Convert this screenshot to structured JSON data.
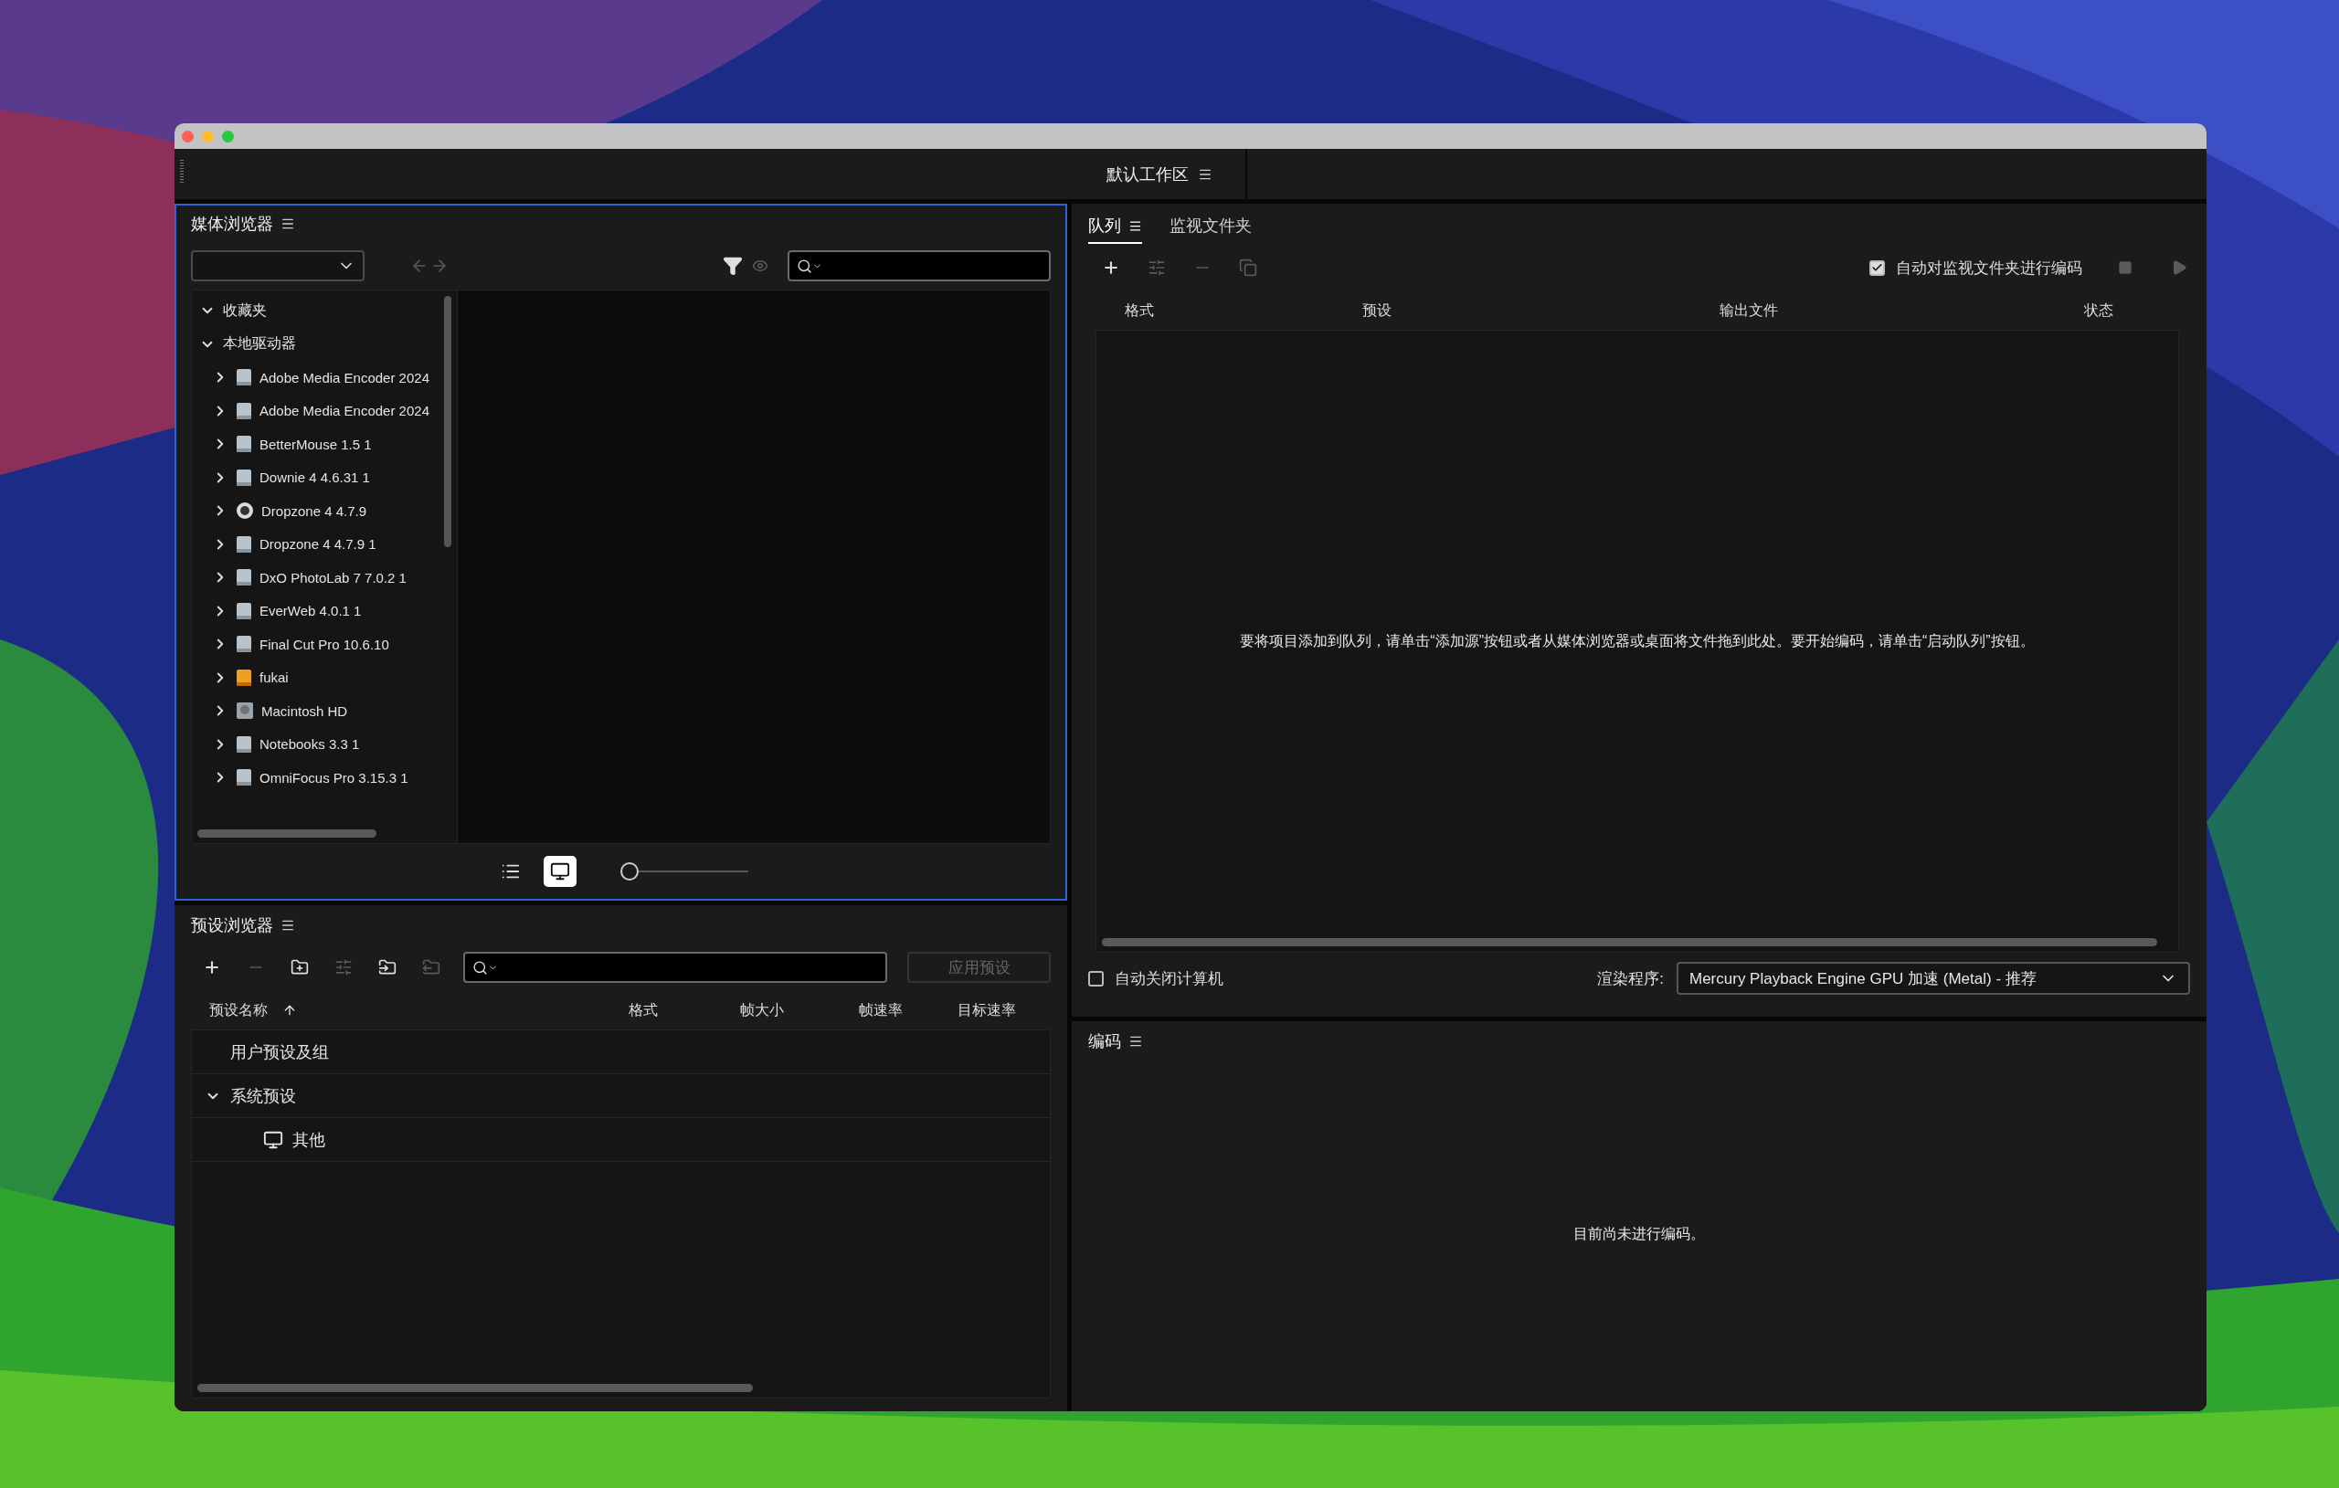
{
  "workspace": {
    "title": "默认工作区"
  },
  "media_browser": {
    "title": "媒体浏览器",
    "focused": true,
    "nav": [
      {
        "kind": "back",
        "disabled": true
      },
      {
        "kind": "forward",
        "disabled": true
      }
    ],
    "tree": [
      {
        "label": "收藏夹",
        "expanded": true
      },
      {
        "label": "本地驱动器",
        "expanded": true,
        "children": [
          {
            "label": "Adobe Media Encoder 2024",
            "expanded": false,
            "kind": "drive"
          },
          {
            "label": "Adobe Media Encoder 2024",
            "expanded": false,
            "kind": "drive"
          },
          {
            "label": "BetterMouse 1.5 1",
            "expanded": false,
            "kind": "drive"
          },
          {
            "label": "Downie 4 4.6.31 1",
            "expanded": false,
            "kind": "drive"
          },
          {
            "label": "Dropzone 4 4.7.9",
            "expanded": false,
            "kind": "disc"
          },
          {
            "label": "Dropzone 4 4.7.9 1",
            "expanded": false,
            "kind": "drive"
          },
          {
            "label": "DxO PhotoLab 7 7.0.2 1",
            "expanded": false,
            "kind": "drive"
          },
          {
            "label": "EverWeb 4.0.1 1",
            "expanded": false,
            "kind": "drive"
          },
          {
            "label": "Final Cut Pro 10.6.10",
            "expanded": false,
            "kind": "drive"
          },
          {
            "label": "fukai",
            "expanded": false,
            "kind": "external"
          },
          {
            "label": "Macintosh HD",
            "expanded": false,
            "kind": "hd"
          },
          {
            "label": "Notebooks 3.3 1",
            "expanded": false,
            "kind": "drive"
          },
          {
            "label": "OmniFocus Pro 3.15.3 1",
            "expanded": false,
            "kind": "drive"
          }
        ]
      }
    ],
    "view_modes": [
      {
        "kind": "list",
        "selected": false
      },
      {
        "kind": "thumbnails",
        "selected": true
      }
    ],
    "zoom": {
      "level": 0
    }
  },
  "preset_browser": {
    "title": "预设浏览器",
    "toolbar": [
      {
        "kind": "add",
        "disabled": false
      },
      {
        "kind": "remove",
        "disabled": true
      },
      {
        "kind": "new_group",
        "disabled": false
      },
      {
        "kind": "settings",
        "disabled": true
      },
      {
        "kind": "import",
        "disabled": false
      },
      {
        "kind": "export",
        "disabled": true
      }
    ],
    "apply_button": {
      "label": "应用预设",
      "disabled": true
    },
    "columns": [
      {
        "label": "预设名称",
        "sorted": true
      },
      {
        "label": "格式",
        "sorted": false
      },
      {
        "label": "帧大小",
        "sorted": false
      },
      {
        "label": "帧速率",
        "sorted": false
      },
      {
        "label": "目标速率",
        "sorted": false
      }
    ],
    "rows": [
      {
        "label": "用户预设及组"
      },
      {
        "label": "系统预设",
        "expanded": true,
        "children": [
          {
            "label": "其他",
            "kind": "monitor"
          }
        ]
      }
    ]
  },
  "queue": {
    "tabs": [
      {
        "label": "队列",
        "selected": true
      },
      {
        "label": "监视文件夹",
        "selected": false
      }
    ],
    "toolbar": [
      {
        "kind": "add",
        "disabled": false
      },
      {
        "kind": "settings",
        "disabled": true
      },
      {
        "kind": "remove",
        "disabled": true
      },
      {
        "kind": "duplicate",
        "disabled": true
      }
    ],
    "auto_encode": {
      "label": "自动对监视文件夹进行编码",
      "checked": true
    },
    "controls": [
      {
        "kind": "stop",
        "disabled": true
      },
      {
        "kind": "start",
        "disabled": true
      }
    ],
    "columns": [
      "格式",
      "预设",
      "输出文件",
      "状态"
    ],
    "empty_message": "要将项目添加到队列，请单击“添加源”按钮或者从媒体浏览器或桌面将文件拖到此处。要开始编码，请单击“启动队列”按钮。",
    "auto_shutdown": {
      "label": "自动关闭计算机",
      "checked": false
    },
    "renderer": {
      "label": "渲染程序:",
      "value": "Mercury Playback Engine GPU 加速 (Metal) - 推荐"
    }
  },
  "encoding": {
    "title": "编码",
    "message": "目前尚未进行编码。"
  }
}
